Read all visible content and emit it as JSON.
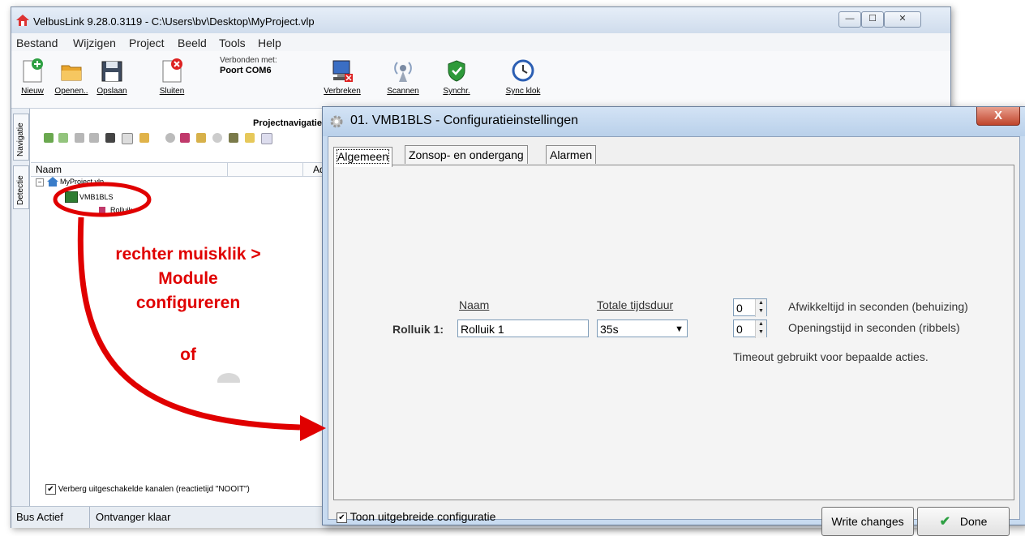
{
  "window": {
    "title": "VelbusLink 9.28.0.3119 - C:\\Users\\bv\\Desktop\\MyProject.vlp",
    "min_glyph": "—",
    "max_glyph": "☐",
    "close_glyph": "✕"
  },
  "menu": [
    "Bestand",
    "Wijzigen",
    "Project",
    "Beeld",
    "Tools",
    "Help"
  ],
  "toolbar": {
    "new": "Nieuw",
    "open": "Openen..",
    "save": "Opslaan",
    "close": "Sluiten",
    "connected_label": "Verbonden met:",
    "connected_port": "Poort COM6",
    "disconnect": "Verbreken",
    "scan": "Scannen",
    "sync": "Synchr.",
    "sync_clock": "Sync klok"
  },
  "leftpanel": {
    "tab_navigation": "Navigatie",
    "tab_detection": "Detectie",
    "title": "Projectnavigatie",
    "col_name": "Naam",
    "col_address": "Add",
    "tree_root": "MyProject.vlp",
    "tree_module": "VMB1BLS",
    "tree_child": "Rolluik",
    "hide_checkbox": "Verberg uitgeschakelde kanalen (reactietijd \"NOOIT\")",
    "check_glyph": "✔"
  },
  "statusbar": {
    "bus": "Bus Actief",
    "receiver": "Ontvanger klaar"
  },
  "dialog": {
    "title": "01. VMB1BLS - Configuratieinstellingen",
    "close_glyph": "X",
    "tabs": [
      "Algemeen",
      "Zonsop- en ondergang",
      "Alarmen"
    ],
    "col_name": "Naam",
    "col_duration": "Totale tijdsduur",
    "row_label": "Rolluik 1:",
    "name_value": "Rolluik 1",
    "duration_value": "35s",
    "dropdown_glyph": "▼",
    "unwind_value": "0",
    "unwind_label": "Afwikkeltijd in seconden (behuizing)",
    "opening_value": "0",
    "opening_label": "Openingstijd in seconden (ribbels)",
    "timeout_note": "Timeout gebruikt voor bepaalde acties.",
    "spin_up": "▲",
    "spin_down": "▼",
    "ext_config_checkbox": "Toon uitgebreide configuratie",
    "check_glyph": "✔",
    "write_button": "Write changes",
    "done_button": "Done",
    "done_glyph": "✔"
  },
  "annotation": {
    "line1": "rechter muisklik >",
    "line2": "Module",
    "line3": "configureren",
    "line4": "of"
  },
  "colors": {
    "annotation_red": "#e00000",
    "accent_green": "#2ea043",
    "close_red": "#c0452c"
  }
}
